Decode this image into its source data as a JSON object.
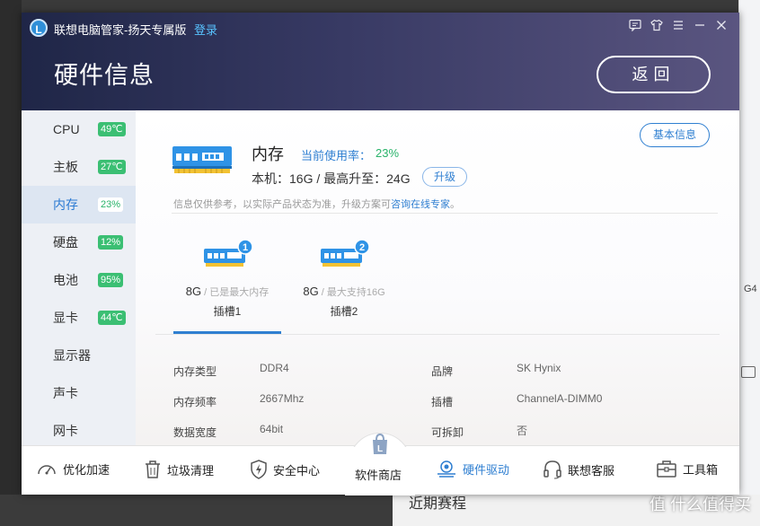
{
  "app": {
    "logo_letter": "L",
    "title": "联想电脑管家-扬天专属版",
    "login_label": "登录",
    "page_title": "硬件信息",
    "back_label": "返回",
    "window_buttons": [
      "feedback-icon",
      "skin-icon",
      "menu-icon",
      "minimize-icon",
      "close-icon"
    ]
  },
  "sidebar": {
    "items": [
      {
        "label": "CPU",
        "pct": "49℃"
      },
      {
        "label": "主板",
        "pct": "27℃"
      },
      {
        "label": "内存",
        "pct": "23%"
      },
      {
        "label": "硬盘",
        "pct": "12%"
      },
      {
        "label": "电池",
        "pct": "95%"
      },
      {
        "label": "显卡",
        "pct": "44℃"
      },
      {
        "label": "显示器",
        "pct": ""
      },
      {
        "label": "声卡",
        "pct": ""
      },
      {
        "label": "网卡",
        "pct": ""
      }
    ],
    "active_index": 2
  },
  "memory": {
    "title": "内存",
    "usage_label": "当前使用率：",
    "usage_value": "23%",
    "capacity_text": "本机：16G / 最高升至：24G",
    "upgrade_label": "升级",
    "basic_info_label": "基本信息",
    "disclaimer": "信息仅供参考，以实际产品状态为准，升级方案可",
    "disclaimer_link": "咨询在线专家",
    "disclaimer_end": "。"
  },
  "slots": [
    {
      "badge": "1",
      "size": "8G",
      "note": " / 已是最大内存",
      "name": "插槽1"
    },
    {
      "badge": "2",
      "size": "8G",
      "note": " / 最大支持16G",
      "name": "插槽2"
    }
  ],
  "details": {
    "left": [
      {
        "key": "内存类型",
        "value": "DDR4"
      },
      {
        "key": "内存频率",
        "value": "2667Mhz"
      },
      {
        "key": "数据宽度",
        "value": "64bit"
      }
    ],
    "right": [
      {
        "key": "品牌",
        "value": "SK Hynix"
      },
      {
        "key": "插槽",
        "value": "ChannelA-DIMM0"
      },
      {
        "key": "可拆卸",
        "value": "否"
      }
    ]
  },
  "bottom_nav": [
    {
      "label": "优化加速",
      "icon": "speedometer-icon"
    },
    {
      "label": "垃圾清理",
      "icon": "trash-icon"
    },
    {
      "label": "安全中心",
      "icon": "shield-icon"
    },
    {
      "label": "软件商店",
      "icon": "store-bag-icon"
    },
    {
      "label": "硬件驱动",
      "icon": "hardware-icon"
    },
    {
      "label": "联想客服",
      "icon": "headset-icon"
    },
    {
      "label": "工具箱",
      "icon": "toolbox-icon"
    }
  ],
  "background": {
    "right_edge_text": "G4",
    "bottom_text": "近期赛程",
    "watermark": "值 什么值得买"
  },
  "colors": {
    "accent_blue": "#2f7fd1",
    "green": "#29b36a",
    "header_dark": "#1f2647",
    "ram_blue": "#2f93e6"
  }
}
